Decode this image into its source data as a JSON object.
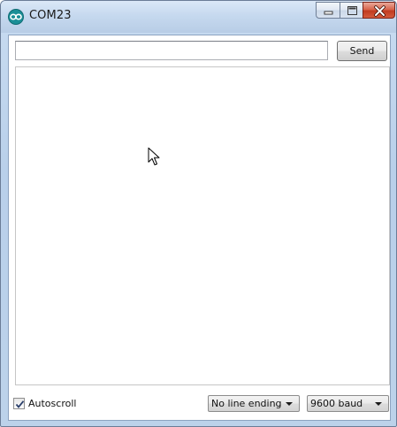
{
  "window": {
    "title": "COM23",
    "app_icon": "arduino-infinity-icon"
  },
  "caption_buttons": {
    "minimize_icon": "minimize-icon",
    "maximize_icon": "maximize-icon",
    "close_icon": "close-icon"
  },
  "send_bar": {
    "input_value": "",
    "send_label": "Send"
  },
  "output": {
    "text": "",
    "cursor_icon": "mouse-pointer-icon"
  },
  "status": {
    "autoscroll_label": "Autoscroll",
    "autoscroll_checked": true,
    "line_ending_selected": "No line ending",
    "baud_selected": "9600 baud"
  },
  "colors": {
    "close_button": "#c13b20",
    "titlebar": "#c6d9ef",
    "app_icon": "#1b8f97"
  }
}
